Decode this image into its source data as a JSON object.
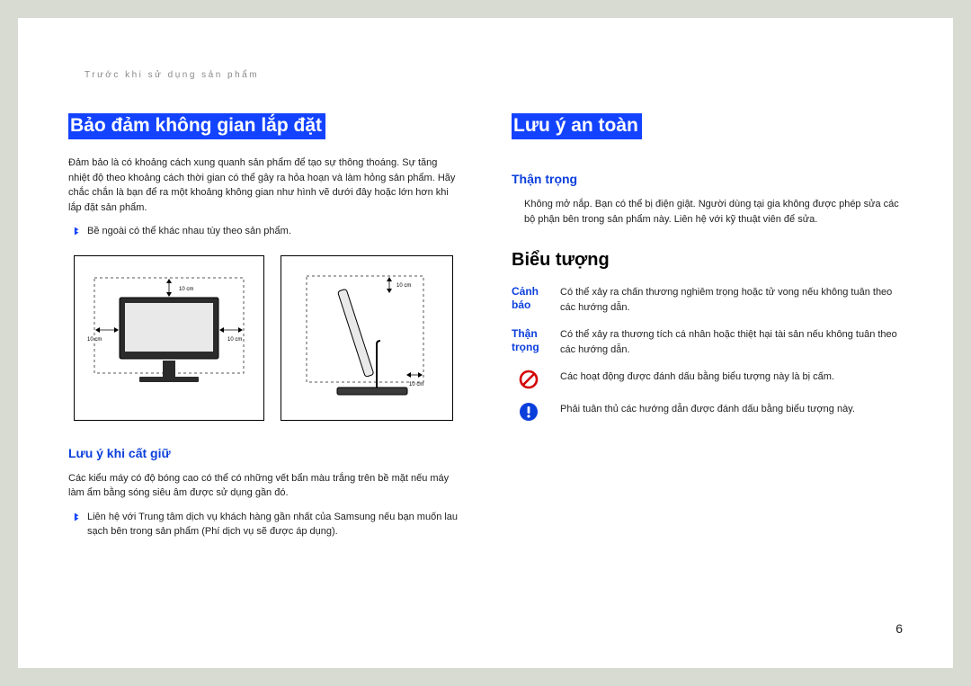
{
  "breadcrumb": "Trước khi sử dụng sản phẩm",
  "left": {
    "h1": "Bảo đảm không gian lắp đặt",
    "para": "Đảm bảo là có khoảng cách xung quanh sản phẩm để tạo sự thông thoáng. Sự tăng nhiệt độ theo khoảng cách thời gian có thể gây ra hỏa hoạn và làm hỏng sản phẩm. Hãy chắc chắn là bạn để ra một khoảng không gian như hình vẽ dưới đây hoặc lớn hơn khi lắp đặt sản phẩm.",
    "bullet1": "Bề ngoài có thể khác nhau tùy theo sản phẩm.",
    "diagram_labels": {
      "top": "10 cm",
      "left": "10 cm",
      "right": "10 cm",
      "side_right": "10 cm"
    },
    "h2_storage": "Lưu ý khi cất giữ",
    "storage_para": "Các kiểu máy có độ bóng cao có thể có những vết bẩn màu trắng trên bề mặt nếu máy làm ẩm bằng sóng siêu âm được sử dụng gần đó.",
    "storage_bullet": "Liên hệ với Trung tâm dịch vụ khách hàng gần nhất của Samsung nếu bạn muốn lau sạch bên trong sản phẩm (Phí dịch vụ sẽ được áp dụng)."
  },
  "right": {
    "h1": "Lưu ý an toàn",
    "h2_caution": "Thận trọng",
    "caution_para": "Không mở nắp. Bạn có thể bị điện giật. Người dùng tại gia không được phép sửa các bộ phận bên trong sản phẩm này. Liên hệ với kỹ thuật viên để sửa.",
    "h2_symbols": "Biểu tượng",
    "legend": [
      {
        "label": "Cảnh báo",
        "text": "Có thể xảy ra chấn thương nghiêm trọng hoặc tử vong nếu không tuân theo các hướng dẫn."
      },
      {
        "label": "Thận trọng",
        "text": "Có thể xảy ra thương tích cá nhân hoặc thiệt hại tài sản nếu không tuân theo các hướng dẫn."
      },
      {
        "icon": "forbidden",
        "text": "Các hoạt động được đánh dấu bằng biểu tượng này là bị cấm."
      },
      {
        "icon": "must",
        "text": "Phải tuân thủ các hướng dẫn được đánh dấu bằng biểu tượng này."
      }
    ]
  },
  "page_number": "6"
}
